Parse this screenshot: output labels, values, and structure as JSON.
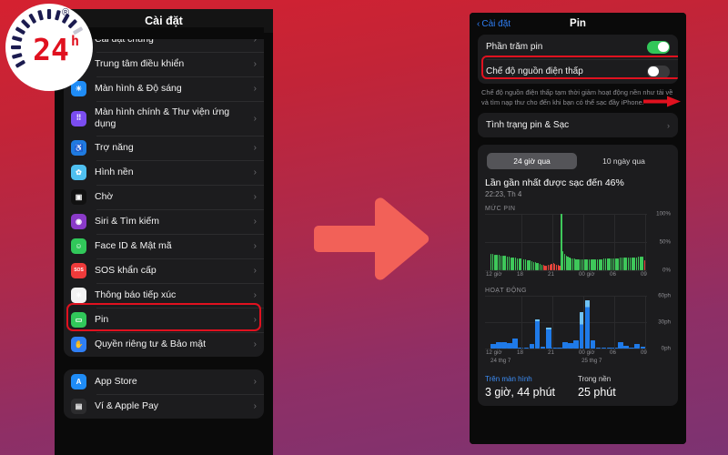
{
  "logo": {
    "text": "24",
    "superscript": "h",
    "registered": "®"
  },
  "center_arrow": {
    "name": "right-arrow",
    "color": "#f26158"
  },
  "left_phone": {
    "header_title": "Cài đặt",
    "groups": [
      {
        "items": [
          {
            "label": "Cài đặt chung",
            "icon": "gear-icon",
            "color": "#8e8e93",
            "glyph": "⚙",
            "clipped": true
          },
          {
            "label": "Trung tâm điều khiển",
            "icon": "control-center-icon",
            "color": "#8e8e93",
            "glyph": "◫"
          },
          {
            "label": "Màn hình & Độ sáng",
            "icon": "brightness-icon",
            "color": "#1f8cf6",
            "glyph": "☀"
          },
          {
            "label": "Màn hình chính & Thư viện ứng dụng",
            "icon": "home-screen-icon",
            "color": "#7b4df0",
            "glyph": "⠿",
            "tall": true
          },
          {
            "label": "Trợ năng",
            "icon": "accessibility-icon",
            "color": "#1f7ae0",
            "glyph": "♿"
          },
          {
            "label": "Hình nền",
            "icon": "wallpaper-icon",
            "color": "#4fc0f0",
            "glyph": "✿"
          },
          {
            "label": "Chờ",
            "icon": "standby-icon",
            "color": "#111111",
            "glyph": "▣"
          },
          {
            "label": "Siri & Tìm kiếm",
            "icon": "siri-icon",
            "color": "#8a3ac8",
            "glyph": "◉"
          },
          {
            "label": "Face ID & Mật mã",
            "icon": "faceid-icon",
            "color": "#31c85a",
            "glyph": "☺"
          },
          {
            "label": "SOS khẩn cấp",
            "icon": "sos-icon",
            "color": "#ef3b3b",
            "glyph": "SOS"
          },
          {
            "label": "Thông báo tiếp xúc",
            "icon": "exposure-icon",
            "color": "#f2f2f2",
            "glyph": "✳"
          },
          {
            "label": "Pin",
            "icon": "battery-icon",
            "color": "#31c85a",
            "glyph": "▭",
            "highlighted": true
          },
          {
            "label": "Quyền riêng tư & Bảo mật",
            "icon": "privacy-icon",
            "color": "#2f7ff5",
            "glyph": "✋"
          }
        ]
      },
      {
        "items": [
          {
            "label": "App Store",
            "icon": "app-store-icon",
            "color": "#1f8cf6",
            "glyph": "A"
          },
          {
            "label": "Ví & Apple Pay",
            "icon": "wallet-icon",
            "color": "#2c2c2e",
            "glyph": "▤"
          }
        ]
      }
    ],
    "chevron": "›"
  },
  "right_phone": {
    "back_label": "Cài đặt",
    "back_chevron": "‹",
    "title": "Pin",
    "rows": [
      {
        "label": "Phần trăm pin",
        "toggle": "on"
      },
      {
        "label": "Chế độ nguồn điện thấp",
        "toggle": "off",
        "highlighted": true
      }
    ],
    "note": "Chế độ nguồn điện thấp tạm thời giảm hoạt động nền như tải về và tìm nạp thư cho đến khi bạn có thể sạc đầy iPhone.",
    "health_row": {
      "label": "Tình trạng pin & Sạc",
      "chevron": "›"
    },
    "segments": [
      {
        "label": "24 giờ qua",
        "active": true
      },
      {
        "label": "10 ngày qua",
        "active": false
      }
    ],
    "last_charge_title": "Lần gần nhất được sạc đến 46%",
    "last_charge_time": "22:23, Th 4",
    "stats": [
      {
        "key": "Trên màn hình",
        "value": "3 giờ, 44 phút"
      },
      {
        "key": "Trong nền",
        "value": "25 phút"
      }
    ]
  },
  "chart_data": [
    {
      "type": "bar",
      "title": "MỨC PIN",
      "ylabel": "",
      "ylim": [
        0,
        100
      ],
      "yticks": [
        "0%",
        "50%",
        "100%"
      ],
      "xticks": [
        "12 giờ",
        "18",
        "21",
        "00 giờ",
        "06",
        "09"
      ],
      "colors": {
        "discharge": "#3ec85a",
        "low": "#e8453c"
      },
      "values": [
        30,
        30,
        29,
        29,
        28,
        28,
        27,
        27,
        26,
        26,
        25,
        25,
        24,
        24,
        23,
        23,
        22,
        22,
        21,
        21,
        20,
        20,
        19,
        19,
        18,
        17,
        16,
        15,
        14,
        13,
        12,
        11,
        10,
        9,
        9,
        10,
        11,
        12,
        13,
        12,
        11,
        10,
        9,
        100,
        34,
        30,
        27,
        25,
        23,
        22,
        21,
        21,
        20,
        20,
        20,
        20,
        20,
        20,
        20,
        20,
        20,
        20,
        20,
        20,
        20,
        20,
        20,
        20,
        20,
        21,
        21,
        21,
        21,
        22,
        22,
        22,
        22,
        22,
        22,
        23,
        23,
        23,
        23,
        24,
        24,
        24,
        24,
        24,
        24,
        24,
        25,
        25,
        25,
        25,
        18
      ],
      "states": [
        "d",
        "d",
        "d",
        "d",
        "d",
        "d",
        "d",
        "d",
        "d",
        "d",
        "d",
        "d",
        "d",
        "d",
        "d",
        "d",
        "d",
        "d",
        "d",
        "d",
        "d",
        "d",
        "d",
        "d",
        "d",
        "d",
        "d",
        "d",
        "d",
        "d",
        "d",
        "d",
        "l",
        "l",
        "l",
        "l",
        "l",
        "l",
        "l",
        "l",
        "l",
        "l",
        "l",
        "d",
        "d",
        "d",
        "d",
        "d",
        "d",
        "d",
        "d",
        "d",
        "d",
        "d",
        "d",
        "d",
        "d",
        "d",
        "d",
        "d",
        "d",
        "d",
        "d",
        "d",
        "d",
        "d",
        "d",
        "d",
        "d",
        "d",
        "d",
        "d",
        "d",
        "d",
        "d",
        "d",
        "d",
        "d",
        "d",
        "d",
        "d",
        "d",
        "d",
        "d",
        "d",
        "d",
        "d",
        "d",
        "d",
        "d",
        "d",
        "d",
        "d",
        "d",
        "l"
      ]
    },
    {
      "type": "bar",
      "title": "HOẠT ĐỘNG",
      "ylim": [
        0,
        60
      ],
      "yticks": [
        "0ph",
        "30ph",
        "60ph"
      ],
      "xticks": [
        "12 giờ",
        "18",
        "21",
        "00 giờ",
        "06",
        "09"
      ],
      "xsub": [
        "24 thg 7",
        "25 thg 7"
      ],
      "colors": {
        "screen": "#1f7ae8",
        "background": "#6fc2f5"
      },
      "values": [
        6,
        8,
        8,
        7,
        12,
        2,
        2,
        6,
        34,
        3,
        24,
        2,
        2,
        8,
        7,
        10,
        42,
        55,
        10,
        1,
        1,
        1,
        1,
        8,
        4,
        2,
        6,
        3
      ],
      "light_tops": [
        0,
        0,
        0,
        0,
        0,
        0,
        0,
        0,
        2,
        0,
        2,
        0,
        0,
        0,
        0,
        0,
        14,
        8,
        0,
        0,
        0,
        0,
        0,
        0,
        0,
        0,
        0,
        0
      ]
    }
  ]
}
